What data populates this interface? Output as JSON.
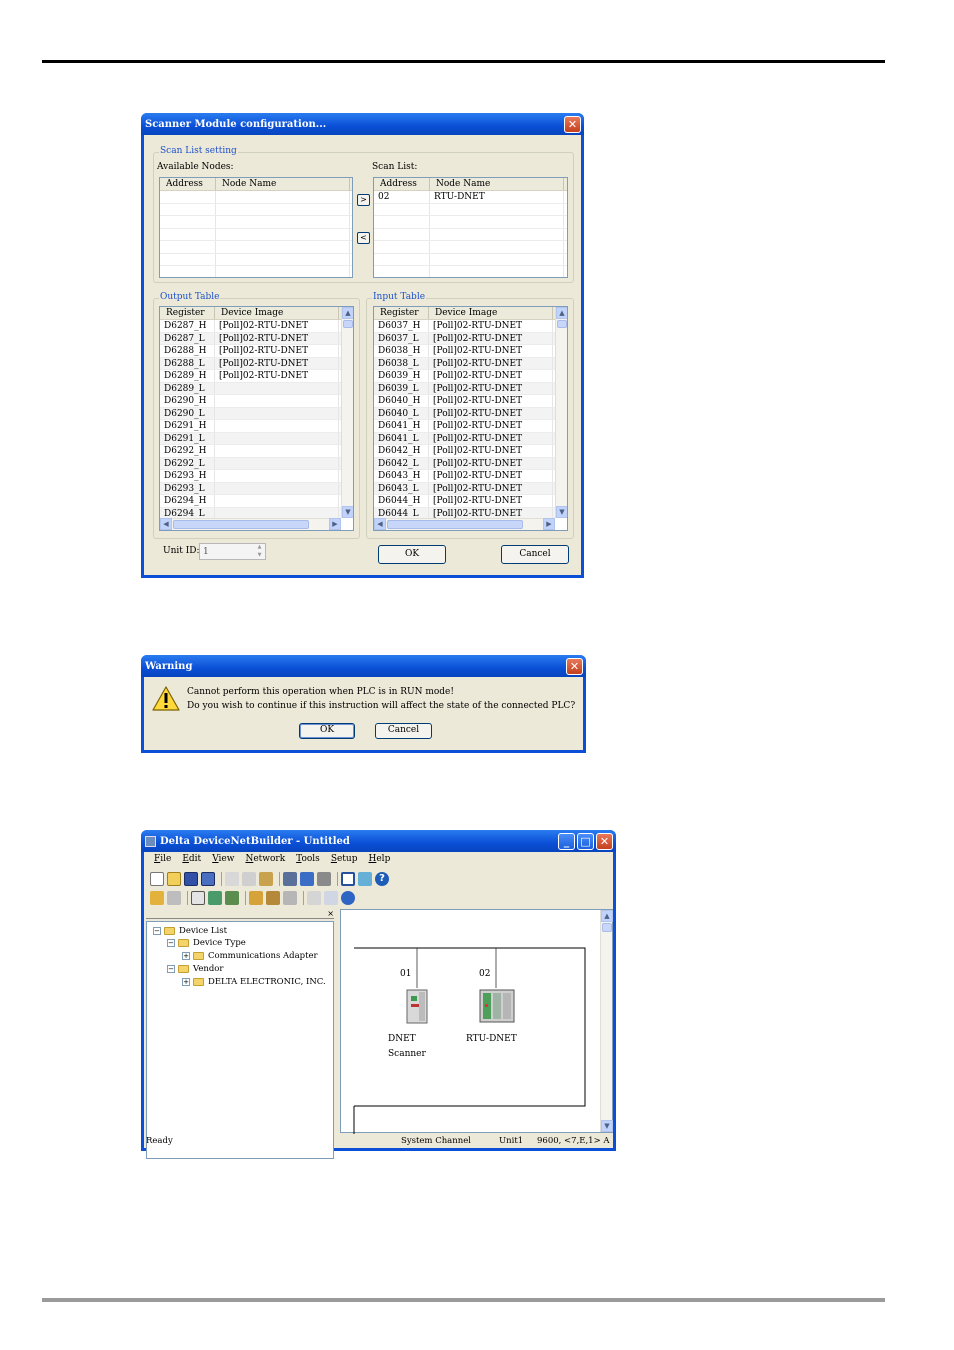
{
  "scanner_dialog": {
    "title": "Scanner Module configuration...",
    "scan_list_group": "Scan List setting",
    "available_nodes_label": "Available Nodes:",
    "scan_list_label": "Scan List:",
    "columns": [
      "Address",
      "Node Name"
    ],
    "scan_list_rows": [
      [
        "02",
        "RTU-DNET"
      ]
    ],
    "add_label": ">",
    "remove_label": "<",
    "output_table": {
      "title": "Output Table",
      "columns": [
        "Register",
        "Device Image"
      ],
      "rows": [
        [
          "D6287_H",
          "[Poll]02-RTU-DNET"
        ],
        [
          "D6287_L",
          "[Poll]02-RTU-DNET"
        ],
        [
          "D6288_H",
          "[Poll]02-RTU-DNET"
        ],
        [
          "D6288_L",
          "[Poll]02-RTU-DNET"
        ],
        [
          "D6289_H",
          "[Poll]02-RTU-DNET"
        ],
        [
          "D6289_L",
          ""
        ],
        [
          "D6290_H",
          ""
        ],
        [
          "D6290_L",
          ""
        ],
        [
          "D6291_H",
          ""
        ],
        [
          "D6291_L",
          ""
        ],
        [
          "D6292_H",
          ""
        ],
        [
          "D6292_L",
          ""
        ],
        [
          "D6293_H",
          ""
        ],
        [
          "D6293_L",
          ""
        ],
        [
          "D6294_H",
          ""
        ],
        [
          "D6294_L",
          ""
        ]
      ]
    },
    "input_table": {
      "title": "Input Table",
      "columns": [
        "Register",
        "Device Image"
      ],
      "rows": [
        [
          "D6037_H",
          "[Poll]02-RTU-DNET"
        ],
        [
          "D6037_L",
          "[Poll]02-RTU-DNET"
        ],
        [
          "D6038_H",
          "[Poll]02-RTU-DNET"
        ],
        [
          "D6038_L",
          "[Poll]02-RTU-DNET"
        ],
        [
          "D6039_H",
          "[Poll]02-RTU-DNET"
        ],
        [
          "D6039_L",
          "[Poll]02-RTU-DNET"
        ],
        [
          "D6040_H",
          "[Poll]02-RTU-DNET"
        ],
        [
          "D6040_L",
          "[Poll]02-RTU-DNET"
        ],
        [
          "D6041_H",
          "[Poll]02-RTU-DNET"
        ],
        [
          "D6041_L",
          "[Poll]02-RTU-DNET"
        ],
        [
          "D6042_H",
          "[Poll]02-RTU-DNET"
        ],
        [
          "D6042_L",
          "[Poll]02-RTU-DNET"
        ],
        [
          "D6043_H",
          "[Poll]02-RTU-DNET"
        ],
        [
          "D6043_L",
          "[Poll]02-RTU-DNET"
        ],
        [
          "D6044_H",
          "[Poll]02-RTU-DNET"
        ],
        [
          "D6044_L",
          "[Poll]02-RTU-DNET"
        ]
      ]
    },
    "unit_id_label": "Unit ID:",
    "unit_id_value": "1",
    "ok_label": "OK",
    "cancel_label": "Cancel"
  },
  "warning_dialog": {
    "title": "Warning",
    "line1": "Cannot perform this operation when PLC is in RUN mode!",
    "line2": "Do you wish to continue if this instruction will affect the state of the connected PLC?",
    "ok_label": "OK",
    "cancel_label": "Cancel"
  },
  "dnb_window": {
    "title": "Delta DeviceNetBuilder - Untitled",
    "menu": [
      "File",
      "Edit",
      "View",
      "Network",
      "Tools",
      "Setup",
      "Help"
    ],
    "tree": {
      "root": "Device List",
      "device_type": "Device Type",
      "comm_adapter": "Communications Adapter",
      "vendor": "Vendor",
      "delta": "DELTA ELECTRONIC, INC."
    },
    "nodes": [
      {
        "address": "01",
        "name_line1": "DNET",
        "name_line2": "Scanner"
      },
      {
        "address": "02",
        "name_line1": "RTU-DNET",
        "name_line2": ""
      }
    ],
    "status": {
      "ready": "Ready",
      "channel": "System Channel",
      "unit": "Unit1",
      "comm": "9600, <7,E,1> A"
    }
  }
}
